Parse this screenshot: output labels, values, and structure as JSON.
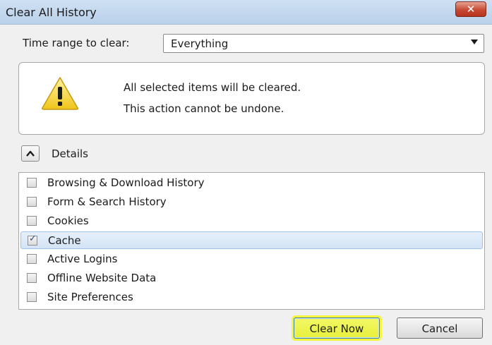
{
  "window": {
    "title": "Clear All History",
    "close_label": "✕"
  },
  "time_range": {
    "label": "Time range to clear:",
    "selected": "Everything"
  },
  "warning": {
    "line1": "All selected items will be cleared.",
    "line2": "This action cannot be undone."
  },
  "details": {
    "label": "Details",
    "expanded": true
  },
  "items": [
    {
      "label": "Browsing & Download History",
      "checked": false
    },
    {
      "label": "Form & Search History",
      "checked": false
    },
    {
      "label": "Cookies",
      "checked": false
    },
    {
      "label": "Cache",
      "checked": true
    },
    {
      "label": "Active Logins",
      "checked": false
    },
    {
      "label": "Offline Website Data",
      "checked": false
    },
    {
      "label": "Site Preferences",
      "checked": false
    }
  ],
  "buttons": {
    "clear_now": "Clear Now",
    "cancel": "Cancel"
  },
  "colors": {
    "highlight": "#f5f53a",
    "selection": "#d3e4f6"
  }
}
